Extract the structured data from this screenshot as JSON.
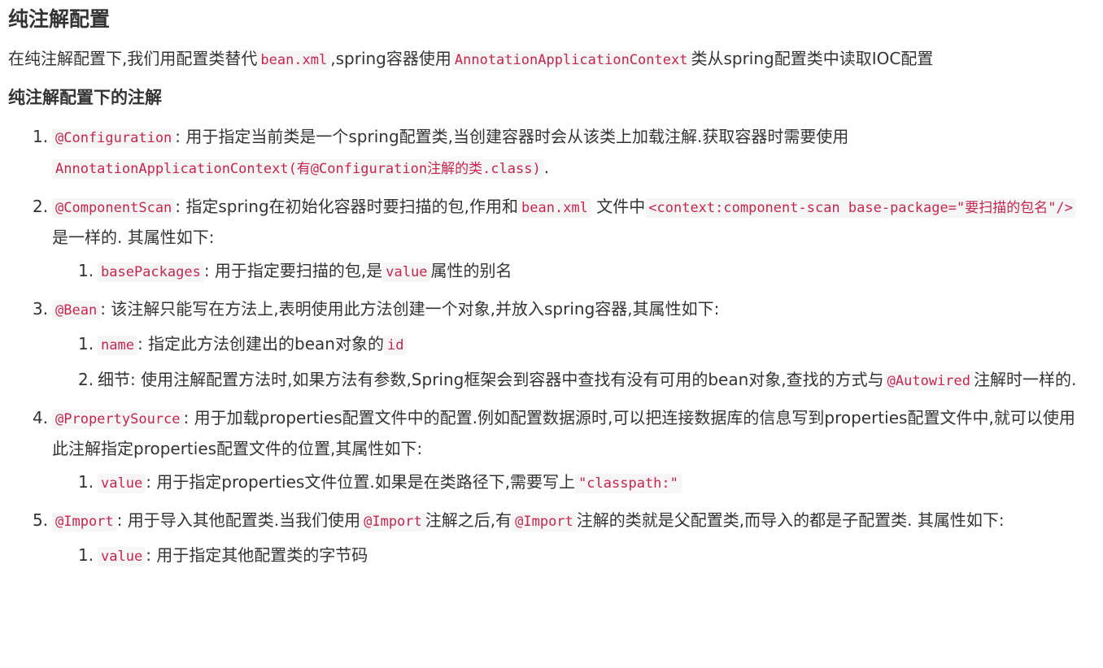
{
  "heading": "纯注解配置",
  "intro": {
    "t1": "在纯注解配置下,我们用配置类替代",
    "c1": "bean.xml",
    "t2": ",spring容器使用",
    "c2": "AnnotationApplicationContext",
    "t3": "类从spring配置类中读取IOC配置"
  },
  "subheading": "纯注解配置下的注解",
  "items": [
    {
      "num": "1.",
      "code1": "@Configuration",
      "t1": ": 用于指定当前类是一个spring配置类,当创建容器时会从该类上加载注解.获取容器时需要使用",
      "code2": "AnnotationApplicationContext(有@Configuration注解的类.class)",
      "t2": "."
    },
    {
      "num": "2.",
      "code1": "@ComponentScan",
      "t1": ": 指定spring在初始化容器时要扫描的包,作用和",
      "code2": "bean.xml",
      "t2": " 文件中",
      "code3": "<context:component-scan base-package=\"要扫描的包名\"/>",
      "t3": "是一样的. 其属性如下:",
      "subs": [
        {
          "num": "1.",
          "code1": "basePackages",
          "t1": ": 用于指定要扫描的包,是",
          "code2": "value",
          "t2": "属性的别名"
        }
      ]
    },
    {
      "num": "3.",
      "code1": "@Bean",
      "t1": ": 该注解只能写在方法上,表明使用此方法创建一个对象,并放入spring容器,其属性如下:",
      "subs": [
        {
          "num": "1.",
          "code1": "name",
          "t1": ": 指定此方法创建出的bean对象的",
          "code2": "id"
        },
        {
          "num": "2.",
          "t0": "细节: 使用注解配置方法时,如果方法有参数,Spring框架会到容器中查找有没有可用的bean对象,查找的方式与",
          "code1": "@Autowired",
          "t1": "注解时一样的."
        }
      ]
    },
    {
      "num": "4.",
      "code1": "@PropertySource",
      "t1": ": 用于加载properties配置文件中的配置.例如配置数据源时,可以把连接数据库的信息写到properties配置文件中,就可以使用此注解指定properties配置文件的位置,其属性如下:",
      "subs": [
        {
          "num": "1.",
          "code1": "value",
          "t1": ": 用于指定properties文件位置.如果是在类路径下,需要写上",
          "code2": "\"classpath:\""
        }
      ]
    },
    {
      "num": "5.",
      "code1": "@Import",
      "t1": ": 用于导入其他配置类.当我们使用",
      "code2": "@Import",
      "t2": "注解之后,有",
      "code3": "@Import",
      "t3": "注解的类就是父配置类,而导入的都是子配置类. 其属性如下:",
      "subs": [
        {
          "num": "1.",
          "code1": "value",
          "t1": ": 用于指定其他配置类的字节码"
        }
      ]
    }
  ]
}
